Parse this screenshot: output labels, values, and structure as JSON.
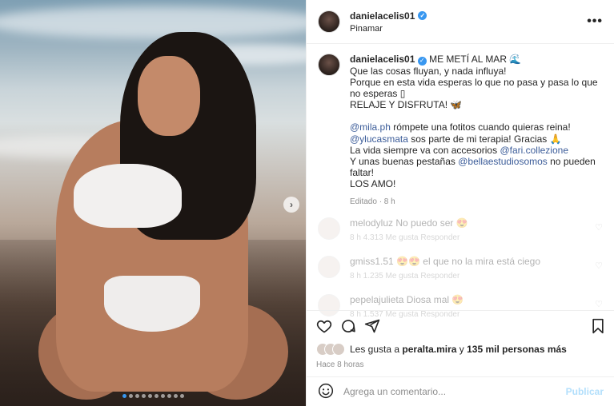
{
  "header": {
    "username": "danielacelis01",
    "location": "Pinamar",
    "more_label": "•••"
  },
  "caption": {
    "username": "danielacelis01",
    "title": "ME METÍ AL MAR 🌊",
    "line1": "Que las cosas fluyan, y nada influya!",
    "line2": "Porque en esta vida esperas lo que no pasa y pasa lo que no esperas ▯",
    "line3": "RELAJE Y DISFRUTA! 🦋",
    "mention1": "@mila.ph",
    "line4_rest": " rómpete una fotitos cuando quieras reina!",
    "mention2": "@ylucasmata",
    "line5_rest": " sos parte de mi terapia! Gracias 🙏",
    "line6_pre": "La vida siempre va con accesorios ",
    "mention3": "@fari.collezione",
    "line7_pre": "Y unas buenas pestañas ",
    "mention4": "@bellaestudiosomos",
    "line7_rest": " no pueden faltar!",
    "line8": "LOS AMO!",
    "edited": "Editado · 8 h"
  },
  "comments": [
    {
      "user": "melodyluz",
      "text": "No puedo ser 😍",
      "meta": "8 h   4.313 Me gusta   Responder"
    },
    {
      "user": "gmiss1.51",
      "text": "😍😍 el que no la mira está ciego",
      "meta": "8 h   1.235 Me gusta   Responder"
    },
    {
      "user": "pepelajulieta",
      "text": "Diosa mal 😍",
      "meta": "8 h   1.537 Me gusta   Responder"
    }
  ],
  "likes": {
    "prefix": "Les gusta a ",
    "user": "peralta.mira",
    "suffix": " y ",
    "count": "135 mil personas más"
  },
  "time": "Hace 8 horas",
  "comment_input": {
    "placeholder": "Agrega un comentario...",
    "publish": "Publicar"
  },
  "carousel": {
    "total": 10,
    "active": 0
  },
  "colors": {
    "accent": "#3897f0",
    "mention": "#3b5c99",
    "publish_disabled": "#b2dffc"
  }
}
